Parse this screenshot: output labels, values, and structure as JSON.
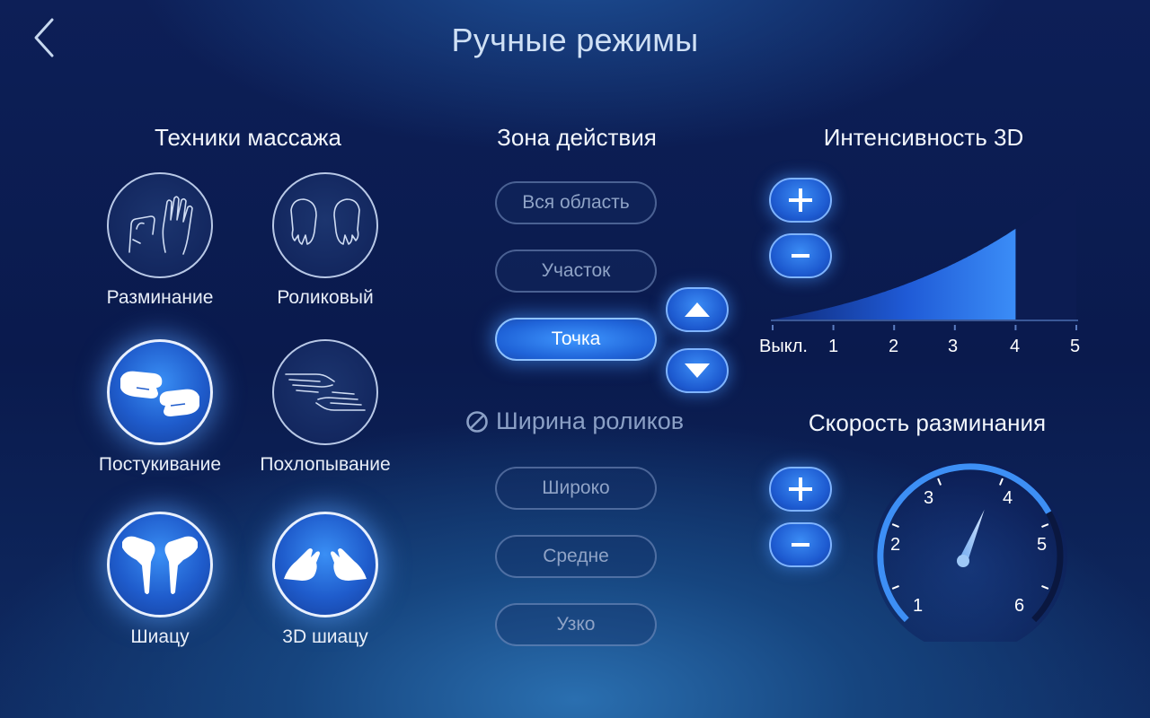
{
  "header": {
    "title": "Ручные режимы"
  },
  "techniques": {
    "title": "Техники массажа",
    "items": [
      {
        "label": "Разминание",
        "icon": "kneading-hands-icon",
        "active": false
      },
      {
        "label": "Роликовый",
        "icon": "rolling-hands-icon",
        "active": false
      },
      {
        "label": "Постукивание",
        "icon": "tapping-fists-icon",
        "active": true
      },
      {
        "label": "Похлопывание",
        "icon": "clapping-hands-icon",
        "active": false
      },
      {
        "label": "Шиацу",
        "icon": "shiatsu-fingers-icon",
        "active": true
      },
      {
        "label": "3D шиацу",
        "icon": "3d-shiatsu-hands-icon",
        "active": true
      }
    ]
  },
  "zone": {
    "title": "Зона действия",
    "options": [
      "Вся область",
      "Участок",
      "Точка"
    ],
    "selected": "Точка"
  },
  "roller_width": {
    "title": "Ширина роликов",
    "options": [
      "Широко",
      "Средне",
      "Узко"
    ],
    "disabled": true
  },
  "intensity": {
    "title": "Интенсивность 3D",
    "ticks": [
      "Выкл.",
      "1",
      "2",
      "3",
      "4",
      "5"
    ],
    "level": 4,
    "max": 5
  },
  "speed": {
    "title": "Скорость разминания",
    "ticks": [
      "1",
      "2",
      "3",
      "4",
      "5",
      "6"
    ],
    "level": 4,
    "max": 6
  },
  "colors": {
    "accent": "#2f7ff0",
    "active_glow": "#5aa0ff",
    "bg": "#0d1f57"
  }
}
